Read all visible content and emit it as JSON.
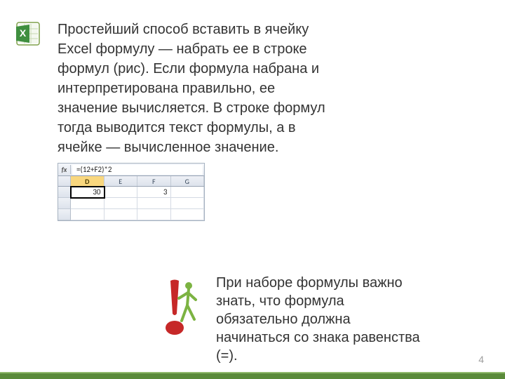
{
  "main_paragraph": "Простейший способ вставить в ячейку Excel формулу — набрать ее в строке формул (рис). Если формула набрана и интерпретирована правильно, ее значение вычисляется. В строке формул тогда выводится текст формулы, а в ячейке — вычисленное значение.",
  "note_paragraph": "При наборе формулы важно знать, что формула обязательно должна начинаться со знака равенства (=).",
  "page_number": "4",
  "formula_bar": {
    "fx_label": "fx",
    "value": "=(12+F2)*2"
  },
  "columns": [
    "D",
    "E",
    "F",
    "G"
  ],
  "active_column_index": 0,
  "rows": [
    {
      "cells": [
        "30",
        "",
        "3",
        ""
      ],
      "active_cell_index": 0
    },
    {
      "cells": [
        "",
        "",
        "",
        ""
      ],
      "active_cell_index": -1
    },
    {
      "cells": [
        "",
        "",
        "",
        ""
      ],
      "active_cell_index": -1
    }
  ]
}
